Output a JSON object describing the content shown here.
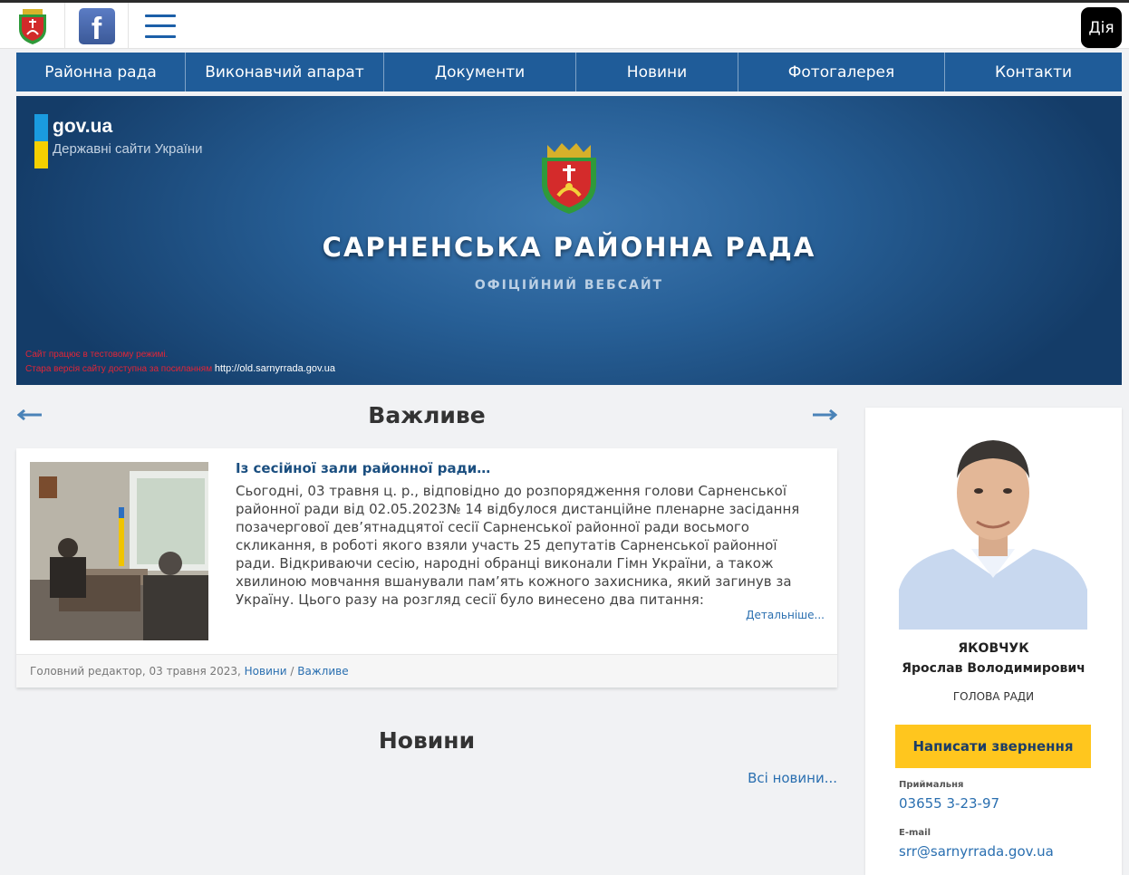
{
  "topbar": {
    "diia_label": "Дія"
  },
  "nav": {
    "items": [
      {
        "label": "Районна рада"
      },
      {
        "label": "Виконавчий апарат"
      },
      {
        "label": "Документи"
      },
      {
        "label": "Новини"
      },
      {
        "label": "Фотогалерея"
      },
      {
        "label": "Контакти"
      }
    ]
  },
  "banner": {
    "gov_title": "gov.ua",
    "gov_subtitle": "Державні сайти України",
    "title": "САРНЕНСЬКА РАЙОННА РАДА",
    "subtitle": "ОФІЦІЙНИЙ ВЕБСАЙТ",
    "note_test": "Сайт працює в тестовому режимі.",
    "note_old": "Стара версія сайту доступна за посиланням",
    "old_link": "http://old.sarnyrrada.gov.ua"
  },
  "important": {
    "heading": "Важливе",
    "article": {
      "title": "Із сесійної зали районної ради…",
      "text": "Сьогодні, 03 травня ц. р., відповідно до розпорядження голови Сарненської районної ради від 02.05.2023№ 14 відбулося дистанційне пленарне засідання позачергової дев’ятнадцятої сесії Сарненської районної ради восьмого скликання, в роботі якого взяли участь 25 депутатів Сарненської районної ради. Відкриваючи сесію, народні обранці виконали Гімн України, а також хвилиною мовчання вшанували пам’ять кожного захисника, який загинув за Україну. Цього разу на розгляд сесії було винесено два питання:",
      "more": "Детальніше...",
      "meta_prefix": "Головний редактор, 03 травня 2023,",
      "cat1": "Новини",
      "sep": "/",
      "cat2": "Важливе"
    }
  },
  "news": {
    "heading": "Новини",
    "all_link": "Всі новини..."
  },
  "sidebar": {
    "surname": "ЯКОВЧУК",
    "name": "Ярослав Володимирович",
    "role": "ГОЛОВА РАДИ",
    "appeal_button": "Написати звернення",
    "reception_label": "Приймальня",
    "phone": "03655 3-23-97",
    "email_label": "E-mail",
    "email": "srr@sarnyrrada.gov.ua"
  },
  "colors": {
    "nav_bg": "#1f5c99",
    "accent_yellow": "#ffc61e",
    "link": "#2a6fb0",
    "alert_red": "#e22537"
  }
}
